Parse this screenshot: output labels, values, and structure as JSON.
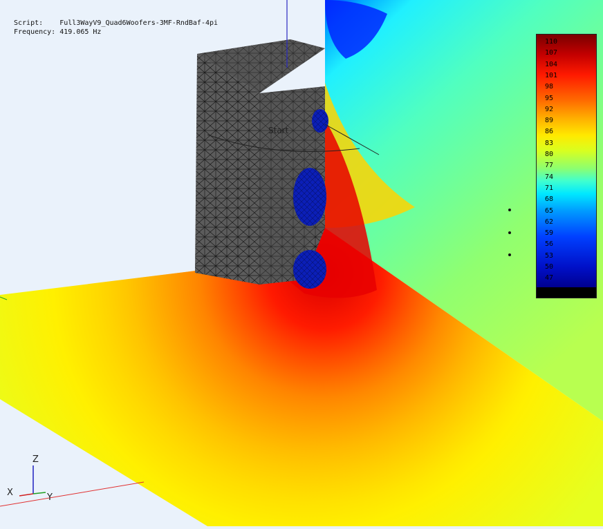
{
  "info": {
    "script_label": "Script:",
    "script_value": "Full3WayV9_Quad6Woofers-3MF-RndBaf-4pi",
    "frequency_label": "Frequency:",
    "frequency_value": "419.065 Hz"
  },
  "legend": {
    "ticks": [
      "110",
      "107",
      "104",
      "101",
      "98",
      "95",
      "92",
      "89",
      "86",
      "83",
      "80",
      "77",
      "74",
      "71",
      "68",
      "65",
      "62",
      "59",
      "56",
      "53",
      "50",
      "47"
    ]
  },
  "scene": {
    "start_label": "Start",
    "axis_labels": {
      "x": "X",
      "y": "Y",
      "z": "Z"
    }
  },
  "colors": {
    "background": "#eaf2fb",
    "enclosure": "#5a5a5a",
    "driver": "#0b1fb8"
  }
}
